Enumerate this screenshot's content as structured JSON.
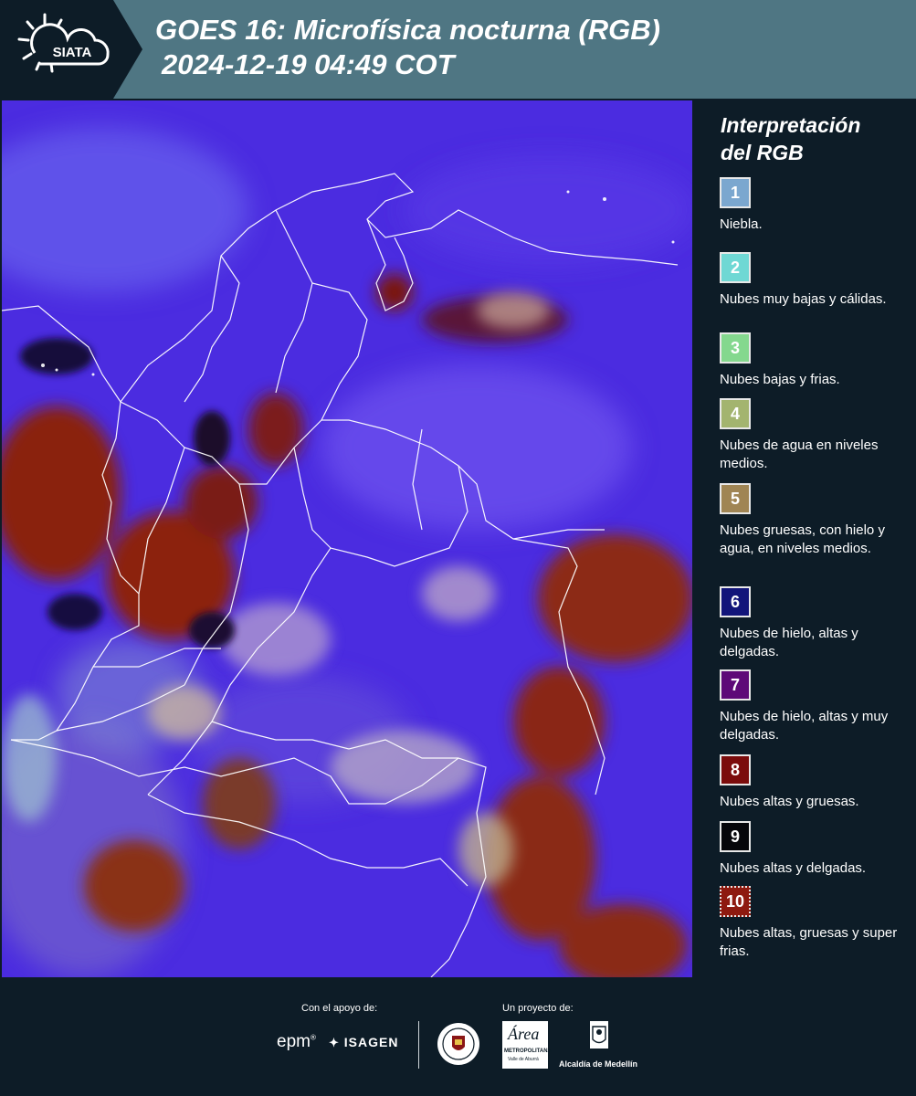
{
  "header": {
    "logo_text": "SIATA",
    "title_line1": "GOES 16: Microfísica nocturna (RGB)",
    "title_line2": "2024-12-19 04:49 COT"
  },
  "legend": {
    "title_line1": "Interpretación",
    "title_line2": "del RGB",
    "items": [
      {
        "number": "1",
        "label": "Niebla.",
        "color": "#7ba7cf"
      },
      {
        "number": "2",
        "label": "Nubes muy bajas y cálidas.",
        "color": "#6fd8d4"
      },
      {
        "number": "3",
        "label": "Nubes bajas y frias.",
        "color": "#84d88e"
      },
      {
        "number": "4",
        "label": "Nubes de agua en niveles medios.",
        "color": "#a3b46f"
      },
      {
        "number": "5",
        "label": "Nubes gruesas, con hielo y agua, en niveles medios.",
        "color": "#a08554"
      },
      {
        "number": "6",
        "label": "Nubes de hielo, altas y delgadas.",
        "color": "#12157a"
      },
      {
        "number": "7",
        "label": "Nubes de hielo, altas y muy delgadas.",
        "color": "#5e0a78"
      },
      {
        "number": "8",
        "label": "Nubes altas y gruesas.",
        "color": "#7b0c0c"
      },
      {
        "number": "9",
        "label": "Nubes altas y delgadas.",
        "color": "#06060a"
      },
      {
        "number": "10",
        "label": "Nubes altas, gruesas y super frias.",
        "color": "#8e1a10"
      }
    ]
  },
  "footer": {
    "support_label": "Con el apoyo de:",
    "project_label": "Un proyecto de:",
    "sponsor_epm": "epm",
    "sponsor_isagen": "ISAGEN",
    "area_label": "Área",
    "area_sub": "METROPOLITANA",
    "area_sub2": "Valle de Aburrá",
    "alcaldia_label": "Alcaldía de Medellín"
  }
}
